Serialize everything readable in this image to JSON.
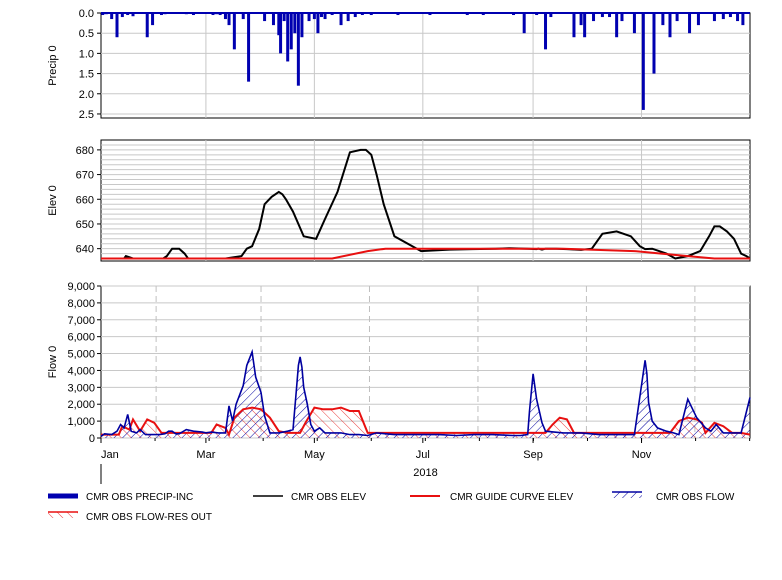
{
  "colors": {
    "precip": "#0000b0",
    "obs_elev": "#000000",
    "guide_curve": "#e81010",
    "obs_flow": "#0000a0",
    "flow_res_out": "#e81010",
    "grid": "#c8c8c8",
    "grid_dashed": "#c0c0c0"
  },
  "legend": [
    {
      "label": "CMR OBS PRECIP-INC",
      "style": "thick-bar",
      "color": "#0000b0"
    },
    {
      "label": "CMR OBS ELEV",
      "style": "line",
      "color": "#000000"
    },
    {
      "label": "CMR GUIDE CURVE ELEV",
      "style": "line",
      "color": "#e81010"
    },
    {
      "label": "CMR OBS FLOW",
      "style": "hatched-line",
      "color": "#0000a0"
    },
    {
      "label": "CMR OBS FLOW-RES OUT",
      "style": "hatched-line",
      "color": "#e81010"
    }
  ],
  "chart_data": [
    {
      "type": "bar",
      "ylabel": "Precip 0",
      "ylim": [
        2.6,
        0
      ],
      "y_inverted": true,
      "yticks": [
        "0.0",
        "0.5",
        "1.0",
        "1.5",
        "2.0",
        "2.5"
      ],
      "x_day_range": [
        0,
        365
      ],
      "series": [
        {
          "name": "CMR OBS PRECIP-INC",
          "x_day": [
            1,
            3,
            6,
            9,
            12,
            15,
            18,
            21,
            26,
            29,
            34,
            36,
            40,
            48,
            52,
            56,
            63,
            65,
            67,
            70,
            72,
            75,
            80,
            83,
            92,
            97,
            100,
            101,
            103,
            105,
            107,
            109,
            111,
            113,
            117,
            120,
            122,
            124,
            126,
            130,
            135,
            139,
            143,
            147,
            152,
            160,
            167,
            175,
            185,
            195,
            206,
            215,
            232,
            238,
            245,
            250,
            253,
            266,
            270,
            272,
            277,
            282,
            286,
            290,
            293,
            300,
            305,
            311,
            316,
            320,
            324,
            331,
            336,
            345,
            350,
            354,
            358,
            361
          ],
          "values": [
            0.05,
            0.03,
            0.15,
            0.6,
            0.1,
            0.05,
            0.08,
            0.02,
            0.6,
            0.3,
            0.05,
            0.03,
            0.02,
            0.03,
            0.05,
            0.02,
            0.05,
            0.03,
            0.05,
            0.15,
            0.3,
            0.9,
            0.15,
            1.7,
            0.2,
            0.3,
            0.55,
            1.0,
            0.2,
            1.2,
            0.9,
            0.5,
            1.8,
            0.6,
            0.2,
            0.15,
            0.5,
            0.1,
            0.15,
            0.05,
            0.3,
            0.2,
            0.1,
            0.05,
            0.05,
            0.02,
            0.05,
            0.02,
            0.05,
            0.02,
            0.05,
            0.05,
            0.05,
            0.5,
            0.05,
            0.9,
            0.1,
            0.6,
            0.3,
            0.6,
            0.2,
            0.1,
            0.1,
            0.6,
            0.2,
            0.5,
            2.4,
            1.5,
            0.3,
            0.6,
            0.2,
            0.5,
            0.3,
            0.2,
            0.15,
            0.1,
            0.2,
            0.3
          ]
        }
      ]
    },
    {
      "type": "line",
      "ylabel": "Elev 0",
      "ylim": [
        635,
        684
      ],
      "yticks": [
        640,
        650,
        660,
        670,
        680
      ],
      "x_day_range": [
        0,
        365
      ],
      "series": [
        {
          "name": "CMR OBS ELEV",
          "x_day": [
            0,
            10,
            13,
            14,
            18,
            21,
            24,
            30,
            35,
            37,
            40,
            44,
            47,
            49,
            55,
            70,
            79,
            82,
            85,
            89,
            92,
            96,
            100,
            102,
            104,
            108,
            111,
            114,
            121,
            126,
            133,
            140,
            146,
            149,
            152,
            155,
            159,
            165,
            180,
            196,
            209,
            222,
            230,
            240,
            245,
            246,
            248,
            250,
            252,
            256,
            262,
            270,
            276,
            282,
            290,
            298,
            303,
            306,
            310,
            318,
            323,
            330,
            337,
            342,
            345,
            348,
            352,
            356,
            360,
            363,
            365
          ],
          "values": [
            636,
            636,
            636,
            637,
            636,
            636,
            636,
            636,
            636,
            637,
            640,
            640,
            638,
            636,
            636,
            636,
            637,
            640,
            641,
            648,
            658,
            661,
            663,
            662,
            660,
            655,
            650,
            645,
            644,
            652,
            663,
            679,
            680,
            680,
            678,
            670,
            658,
            645,
            639,
            639.6,
            639.8,
            640,
            640.2,
            640,
            639.8,
            640,
            639.6,
            640,
            640,
            640,
            639.8,
            639.5,
            640,
            646,
            647,
            645,
            641,
            639.8,
            640,
            638,
            636,
            637,
            639,
            645,
            649,
            649,
            647,
            644,
            638,
            637,
            636
          ]
        },
        {
          "name": "CMR GUIDE CURVE ELEV",
          "x_day": [
            0,
            20,
            40,
            120,
            130,
            150,
            160,
            240,
            260,
            300,
            330,
            345,
            365
          ],
          "values": [
            636,
            636,
            636,
            636,
            636,
            639,
            640,
            640,
            640,
            639,
            637,
            636,
            636
          ]
        }
      ]
    },
    {
      "type": "area",
      "ylabel": "Flow 0",
      "ylim": [
        0,
        9000
      ],
      "yticks": [
        "0",
        "1,000",
        "2,000",
        "3,000",
        "4,000",
        "5,000",
        "6,000",
        "7,000",
        "8,000",
        "9,000"
      ],
      "x_day_range": [
        0,
        365
      ],
      "x_month_labels": [
        "Jan",
        "Mar",
        "May",
        "Jul",
        "Sep",
        "Nov"
      ],
      "x_month_days": [
        0,
        59,
        120,
        181,
        243,
        304
      ],
      "x_year_label": "2018",
      "series": [
        {
          "name": "CMR OBS FLOW",
          "x_day": [
            0,
            2,
            6,
            9,
            11,
            13,
            15,
            17,
            20,
            22,
            25,
            28,
            33,
            36,
            38,
            40,
            42,
            44,
            48,
            52,
            57,
            59,
            62,
            66,
            70,
            72,
            74,
            76,
            80,
            82,
            85,
            87,
            90,
            92,
            95,
            100,
            105,
            108,
            110,
            111,
            112,
            113,
            114,
            116,
            118,
            120,
            123,
            126,
            130,
            135,
            140,
            145,
            150,
            155,
            160,
            165,
            170,
            175,
            180,
            190,
            200,
            210,
            220,
            232,
            236,
            240,
            241,
            243,
            245,
            248,
            250,
            260,
            270,
            280,
            290,
            300,
            306,
            307,
            308,
            310,
            313,
            318,
            322,
            325,
            330,
            335,
            340,
            343,
            346,
            350,
            355,
            360,
            365
          ],
          "values": [
            100,
            250,
            200,
            400,
            800,
            600,
            1400,
            400,
            300,
            500,
            200,
            200,
            200,
            250,
            400,
            400,
            250,
            250,
            500,
            400,
            350,
            300,
            350,
            300,
            300,
            1900,
            1000,
            2000,
            3100,
            4300,
            5100,
            3600,
            2700,
            1300,
            300,
            300,
            400,
            500,
            3000,
            4300,
            4800,
            4200,
            3000,
            2000,
            800,
            400,
            600,
            300,
            300,
            300,
            200,
            200,
            150,
            300,
            250,
            200,
            200,
            200,
            200,
            200,
            150,
            200,
            200,
            150,
            150,
            200,
            1600,
            3800,
            2300,
            900,
            400,
            300,
            300,
            200,
            200,
            200,
            4600,
            3800,
            2100,
            1000,
            600,
            400,
            300,
            200,
            2300,
            1200,
            600,
            400,
            800,
            300,
            300,
            300,
            2400
          ]
        },
        {
          "name": "CMR OBS FLOW-RES OUT",
          "x_day": [
            0,
            10,
            12,
            16,
            18,
            22,
            26,
            30,
            34,
            38,
            45,
            55,
            60,
            62,
            65,
            70,
            72,
            75,
            80,
            85,
            90,
            95,
            100,
            105,
            108,
            112,
            115,
            120,
            125,
            130,
            135,
            140,
            145,
            150,
            160,
            170,
            180,
            190,
            200,
            210,
            220,
            230,
            240,
            245,
            250,
            254,
            258,
            262,
            266,
            270,
            280,
            290,
            300,
            310,
            320,
            325,
            330,
            335,
            338,
            340,
            345,
            350,
            355,
            360,
            365
          ],
          "values": [
            200,
            200,
            700,
            500,
            1100,
            400,
            1100,
            900,
            300,
            300,
            300,
            300,
            300,
            300,
            800,
            600,
            200,
            1200,
            1700,
            1800,
            1700,
            1200,
            400,
            300,
            300,
            300,
            900,
            1800,
            1700,
            1700,
            1800,
            1600,
            1600,
            300,
            300,
            300,
            300,
            300,
            300,
            300,
            300,
            300,
            300,
            300,
            300,
            800,
            1200,
            1100,
            300,
            300,
            300,
            300,
            300,
            300,
            300,
            1000,
            1200,
            1100,
            900,
            300,
            900,
            700,
            300,
            300,
            200
          ]
        }
      ]
    }
  ]
}
